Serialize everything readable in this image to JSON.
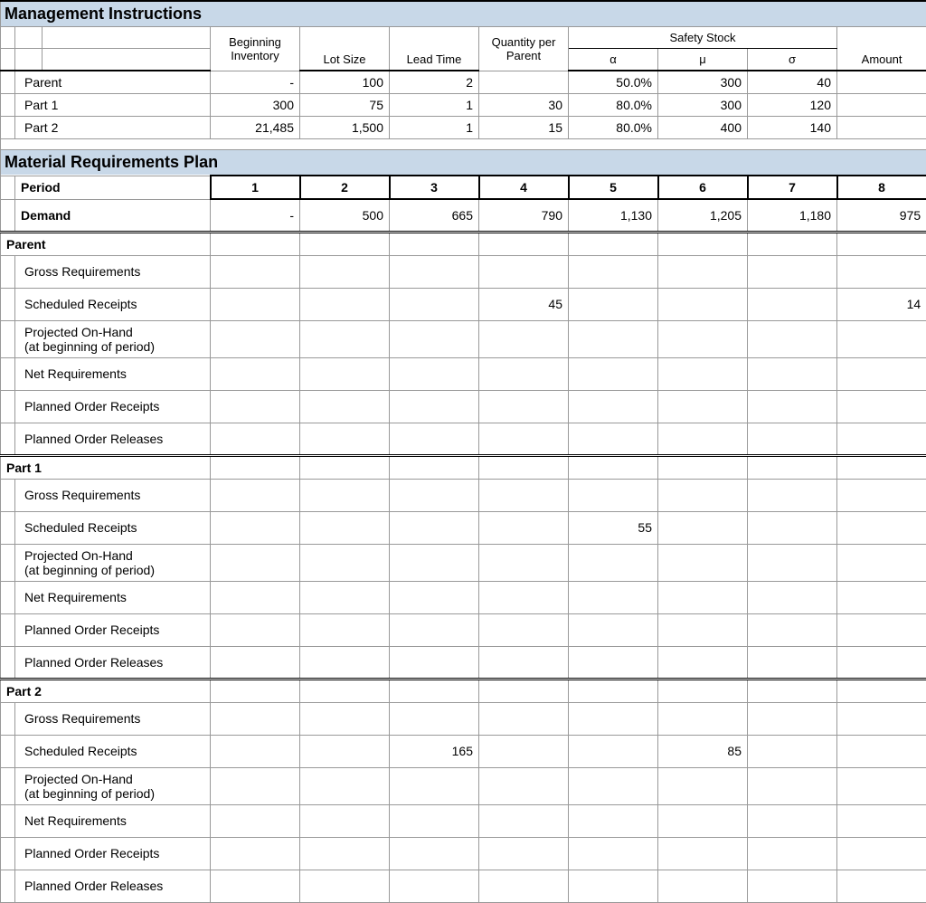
{
  "sections": {
    "mgmt": "Management Instructions",
    "mrp": "Material Requirements Plan"
  },
  "mgmt_headers": {
    "begin_inv": "Beginning\nInventory",
    "lot_size": "Lot Size",
    "lead_time": "Lead Time",
    "qty_parent": "Quantity per\nParent",
    "safety_stock": "Safety Stock",
    "alpha": "α",
    "mu": "μ",
    "sigma": "σ",
    "amount": "Amount"
  },
  "mgmt_rows": [
    {
      "name": "Parent",
      "begin_inv": "-",
      "lot_size": "100",
      "lead_time": "2",
      "qty_parent": "",
      "alpha": "50.0%",
      "mu": "300",
      "sigma": "40",
      "amount": ""
    },
    {
      "name": "Part 1",
      "begin_inv": "300",
      "lot_size": "75",
      "lead_time": "1",
      "qty_parent": "30",
      "alpha": "80.0%",
      "mu": "300",
      "sigma": "120",
      "amount": ""
    },
    {
      "name": "Part 2",
      "begin_inv": "21,485",
      "lot_size": "1,500",
      "lead_time": "1",
      "qty_parent": "15",
      "alpha": "80.0%",
      "mu": "400",
      "sigma": "140",
      "amount": ""
    }
  ],
  "mrp": {
    "period_label": "Period",
    "demand_label": "Demand",
    "periods": [
      "1",
      "2",
      "3",
      "4",
      "5",
      "6",
      "7",
      "8"
    ],
    "demand": [
      "-",
      "500",
      "665",
      "790",
      "1,130",
      "1,205",
      "1,180",
      "975"
    ]
  },
  "item_labels": {
    "gross": "Gross Requirements",
    "sched": "Scheduled Receipts",
    "onhand1": "Projected On-Hand",
    "onhand2": "(at beginning of period)",
    "net": "Net Requirements",
    "por": "Planned Order Receipts",
    "porl": "Planned Order Releases"
  },
  "items": [
    {
      "name": "Parent",
      "sched": [
        "",
        "",
        "",
        "45",
        "",
        "",
        "",
        "14"
      ]
    },
    {
      "name": "Part 1",
      "sched": [
        "",
        "",
        "",
        "",
        "55",
        "",
        "",
        ""
      ]
    },
    {
      "name": "Part 2",
      "sched": [
        "",
        "",
        "165",
        "",
        "",
        "85",
        "",
        ""
      ]
    }
  ]
}
